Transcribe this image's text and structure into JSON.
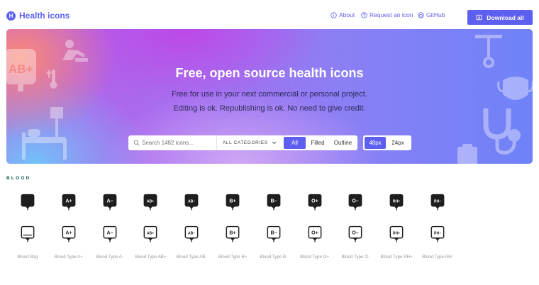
{
  "header": {
    "brand": "Health icons",
    "logo_letter": "H",
    "nav": {
      "about": "About",
      "request": "Request an icon",
      "github": "GitHub"
    },
    "download": "Download all"
  },
  "hero": {
    "title": "Free, open source health icons",
    "subtitle_1": "Free for use in your next commercial or personal project.",
    "subtitle_2": "Editing is ok. Republishing is ok. No need to give credit.",
    "search_placeholder": "Search 1482 icons...",
    "category": "ALL CATEGORIES",
    "filters": [
      "All",
      "Filled",
      "Outline"
    ],
    "active_filter": "All",
    "sizes": [
      "48px",
      "24px"
    ],
    "active_size": "48px",
    "deco_text": "AB+"
  },
  "section": {
    "title": "BLOOD",
    "icons": [
      {
        "name": "Blood Bag",
        "code": ""
      },
      {
        "name": "Blood Type A+",
        "code": "A+"
      },
      {
        "name": "Blood Type A-",
        "code": "A–"
      },
      {
        "name": "Blood Type AB+",
        "code": "AB+"
      },
      {
        "name": "Blood Type AB-",
        "code": "AB–"
      },
      {
        "name": "Blood Type B+",
        "code": "B+"
      },
      {
        "name": "Blood Type B-",
        "code": "B–"
      },
      {
        "name": "Blood Type O+",
        "code": "O+"
      },
      {
        "name": "Blood Type O-",
        "code": "O–"
      },
      {
        "name": "Blood Type RH+",
        "code": "RH+"
      },
      {
        "name": "Blood Type RH-",
        "code": "RH–"
      }
    ]
  },
  "colors": {
    "accent": "#5d5fef",
    "section_title": "#0e5f52",
    "icon": "#1e1e1e"
  }
}
